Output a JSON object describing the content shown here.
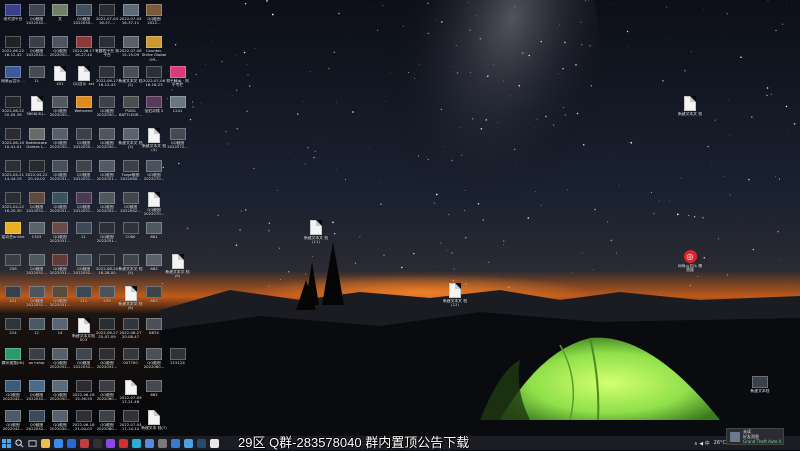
{
  "colors": {
    "taskbar": "#1b1d22",
    "tent": "#8fe04a",
    "horizon": "#e0661a",
    "sky": "#1a2130"
  },
  "desktop": {
    "icons": [
      {
        "label": "现代游平台",
        "kind": "app",
        "color": "#3a3f8a"
      },
      {
        "label": "QQ截图 2022042...",
        "kind": "shot",
        "color": "#3d4550"
      },
      {
        "label": "文",
        "kind": "app",
        "color": "#6f7f6a"
      },
      {
        "label": "QQ截图 2022050...",
        "kind": "shot",
        "color": "#41505e"
      },
      {
        "label": "2022-07-04 16-37-...",
        "kind": "shot",
        "color": "#2a2a30"
      },
      {
        "label": "2022-07-04 16-37-11",
        "kind": "shot",
        "color": "#5c6a78"
      },
      {
        "label": "QQ截图 2022...",
        "kind": "shot",
        "color": "#7a5a3a"
      },
      {
        "label": "2022-06-22 16-12-42",
        "kind": "shot",
        "color": "#202226"
      },
      {
        "label": "QQ截图 2022042...",
        "kind": "shot",
        "color": "#384046"
      },
      {
        "label": "QQ截图 2022050...",
        "kind": "shot",
        "color": "#4c5560"
      },
      {
        "label": "2022-06-17 16-27-40",
        "kind": "shot",
        "color": "#8a3a3a"
      },
      {
        "label": "有趣的平台 知平台",
        "kind": "shot",
        "color": "#2a2e35"
      },
      {
        "label": "2022-07-06 15-15-09",
        "kind": "shot",
        "color": "#5a6069"
      },
      {
        "label": "Counter-Strike Global Off...",
        "kind": "app",
        "color": "#c99a2e"
      },
      {
        "label": "网易云音乐 ...",
        "kind": "app",
        "color": "#3c5a9a"
      },
      {
        "label": "11",
        "kind": "shot",
        "color": "#454b55"
      },
      {
        "label": "451",
        "kind": "doc",
        "color": "#e8e8e8"
      },
      {
        "label": "QQ音乐 .txt",
        "kind": "doc",
        "color": "#e0e0e0"
      },
      {
        "label": "2022-06-17 16-12-43",
        "kind": "shot",
        "color": "#2f3338"
      },
      {
        "label": "新建文本文 档(2)",
        "kind": "shot",
        "color": "#4a4f57"
      },
      {
        "label": "2022-07-06 16-16-23",
        "kind": "shot",
        "color": "#2b2f37"
      },
      {
        "label": "和平精英 · 知乎专栏",
        "kind": "app",
        "color": "#d93a78"
      },
      {
        "label": "2022-06-22 20-05-36",
        "kind": "shot",
        "color": "#222428"
      },
      {
        "label": "3608(ID)...",
        "kind": "doc",
        "color": "#dcdcdc"
      },
      {
        "label": "QQ截图 2022050...",
        "kind": "shot",
        "color": "#505862"
      },
      {
        "label": "Wetnome",
        "kind": "app",
        "color": "#e08a1e"
      },
      {
        "label": "QQ截图 2022050...",
        "kind": "shot",
        "color": "#3c4249"
      },
      {
        "label": "PUBG BATTLEGR...",
        "kind": "app",
        "color": "#4d4d4d"
      },
      {
        "label": "仙侣奇缘 2",
        "kind": "app",
        "color": "#5a3a5a"
      },
      {
        "label": "1241",
        "kind": "shot",
        "color": "#6a7684"
      },
      {
        "label": "2022-06-10 10-41-01",
        "kind": "shot",
        "color": "#2a2c31"
      },
      {
        "label": "Battlestate Games L...",
        "kind": "app",
        "color": "#6a6a6a"
      },
      {
        "label": "QQ截图 2022050...",
        "kind": "shot",
        "color": "#56606a"
      },
      {
        "label": "QQ截图 2022050...",
        "kind": "shot",
        "color": "#3b4148"
      },
      {
        "label": "QQ截图 2022050...",
        "kind": "shot",
        "color": "#4e555d"
      },
      {
        "label": "新建文本文 档(3)",
        "kind": "shot",
        "color": "#5a6470"
      },
      {
        "label": "新建文本文 档(4)",
        "kind": "doc",
        "color": "#e8e8e8"
      },
      {
        "label": "QQ截图 2022072...",
        "kind": "shot",
        "color": "#434a52"
      },
      {
        "label": "2022-04-21 14-44-15",
        "kind": "shot",
        "color": "#2c3036"
      },
      {
        "label": "2022-04-22 20-10-02",
        "kind": "shot",
        "color": "#262a2e"
      },
      {
        "label": "QQ截图 2022051...",
        "kind": "shot",
        "color": "#48505a"
      },
      {
        "label": "QQ截图 2022051...",
        "kind": "shot",
        "color": "#3e444c"
      },
      {
        "label": "QQ截图 2022051...",
        "kind": "shot",
        "color": "#525a64"
      },
      {
        "label": "Fxige截图 2022060...",
        "kind": "shot",
        "color": "#3a4047"
      },
      {
        "label": "QQ截图 2022070...",
        "kind": "shot",
        "color": "#4a525c"
      },
      {
        "label": "2022-04-22 16-20-30",
        "kind": "shot",
        "color": "#2a2e33"
      },
      {
        "label": "QQ截图 2022051...",
        "kind": "shot",
        "color": "#5c4a3a"
      },
      {
        "label": "QQ截图 2022051...",
        "kind": "shot",
        "color": "#3a5260"
      },
      {
        "label": "QQ截图 2022051...",
        "kind": "shot",
        "color": "#4a3a52"
      },
      {
        "label": "QQ截图 2022052...",
        "kind": "shot",
        "color": "#50585f"
      },
      {
        "label": "QQ截图 2022062...",
        "kind": "shot",
        "color": "#3f464e"
      },
      {
        "label": "QQ截图 2022070...",
        "kind": "doc",
        "color": "#e8e8e8"
      },
      {
        "label": "爱奇艺online",
        "kind": "app",
        "color": "#e8b020"
      },
      {
        "label": "1353",
        "kind": "shot",
        "color": "#5a626c"
      },
      {
        "label": "QQ截图 2022051...",
        "kind": "shot",
        "color": "#6a4a4a"
      },
      {
        "label": "11",
        "kind": "shot",
        "color": "#3c4a58"
      },
      {
        "label": "QQ截图 2022051...",
        "kind": "shot",
        "color": "#2c3036"
      },
      {
        "label": "C080",
        "kind": "shot",
        "color": "#2f3338"
      },
      {
        "label": "881",
        "kind": "shot",
        "color": "#50585f"
      },
      {
        "label": "258",
        "kind": "shot",
        "color": "#3a3f46"
      },
      {
        "label": "QQ截图 2022051...",
        "kind": "shot",
        "color": "#4e565e"
      },
      {
        "label": "QQ截图 2022051...",
        "kind": "shot",
        "color": "#623a3a"
      },
      {
        "label": "QQ截图 2022052...",
        "kind": "shot",
        "color": "#48505a"
      },
      {
        "label": "2022-06-20 16-28-00",
        "kind": "shot",
        "color": "#2b2f35"
      },
      {
        "label": "新建文本文 档(5)",
        "kind": "shot",
        "color": "#3e454d"
      },
      {
        "label": "882",
        "kind": "shot",
        "color": "#5a6068"
      },
      {
        "label": "新建文本文 档(6)",
        "kind": "doc",
        "color": "#e8e8e8"
      },
      {
        "label": "421",
        "kind": "shot",
        "color": "#3a4048"
      },
      {
        "label": "QQ截图 2022051...",
        "kind": "shot",
        "color": "#4c545e"
      },
      {
        "label": "QQ截图 2022051...",
        "kind": "shot",
        "color": "#5a4a3c"
      },
      {
        "label": "111",
        "kind": "shot",
        "color": "#3a4a54"
      },
      {
        "label": "239",
        "kind": "shot",
        "color": "#4a525a"
      },
      {
        "label": "新建文本文 档(8)",
        "kind": "doc",
        "color": "#e8e8e8"
      },
      {
        "label": "883",
        "kind": "shot",
        "color": "#3c434b"
      },
      {
        "label": "214",
        "kind": "shot",
        "color": "#2f343a"
      },
      {
        "label": "12",
        "kind": "shot",
        "color": "#4a5862"
      },
      {
        "label": "14",
        "kind": "shot",
        "color": "#5a6470"
      },
      {
        "label": "新建文本文档003",
        "kind": "doc",
        "color": "#e8e8e8"
      },
      {
        "label": "2022-06-27 20-07-09",
        "kind": "shot",
        "color": "#2a2d32"
      },
      {
        "label": "2022-06-27 20-08-47",
        "kind": "shot",
        "color": "#33373d"
      },
      {
        "label": "8874",
        "kind": "shot",
        "color": "#4c5058"
      },
      {
        "label": "腾讯视频(Ht)",
        "kind": "app",
        "color": "#2a9a6a"
      },
      {
        "label": "on+ship",
        "kind": "shot",
        "color": "#3a3f46"
      },
      {
        "label": "QQ截图 2022052...",
        "kind": "shot",
        "color": "#56606a"
      },
      {
        "label": "QQ截图 2022052...",
        "kind": "shot",
        "color": "#3e454e"
      },
      {
        "label": "QQ截图 2022052...",
        "kind": "shot",
        "color": "#2b2e33"
      },
      {
        "label": "007700",
        "kind": "shot",
        "color": "#34383e"
      },
      {
        "label": "QQ截图 2022060...",
        "kind": "shot",
        "color": "#4a5058"
      },
      {
        "label": "215124",
        "kind": "shot",
        "color": "#2f3238"
      },
      {
        "label": "QQ截图 2022042...",
        "kind": "shot",
        "color": "#3c5a7a"
      },
      {
        "label": "QQ截图 2022042...",
        "kind": "shot",
        "color": "#4a6a8a"
      },
      {
        "label": "QQ截图 2022050...",
        "kind": "shot",
        "color": "#5a6a7a"
      },
      {
        "label": "2022-06-18 15-36-55",
        "kind": "shot",
        "color": "#2a2c31"
      },
      {
        "label": "QQ截图 2022060...",
        "kind": "shot",
        "color": "#3a3e44"
      },
      {
        "label": "2022-07-09 17-21-48",
        "kind": "doc",
        "color": "#e8e8e8"
      },
      {
        "label": "662",
        "kind": "shot",
        "color": "#45494f"
      },
      {
        "label": "QQ截图 2022042...",
        "kind": "shot",
        "color": "#4a5a6a"
      },
      {
        "label": "QQ截图 2022042...",
        "kind": "shot",
        "color": "#3a4a5a"
      },
      {
        "label": "QQ截图 2022050...",
        "kind": "shot",
        "color": "#56626e"
      },
      {
        "label": "2022-06-18 21-04-01",
        "kind": "shot",
        "color": "#2c2f34"
      },
      {
        "label": "QQ截图 2022060...",
        "kind": "shot",
        "color": "#3c4148"
      },
      {
        "label": "2022-07-04 17-14-14",
        "kind": "shot",
        "color": "#2f3338"
      },
      {
        "label": "新建文本 档(7)",
        "kind": "doc",
        "color": "#dcdcdc"
      }
    ],
    "free_icons": [
      {
        "label": "新建文本文 档",
        "kind": "doc"
      },
      {
        "label": "新建文本文 档(11)",
        "kind": "doc"
      },
      {
        "label": "新建文本文 档(12)",
        "kind": "doc"
      },
      {
        "label": "网易云音乐 播放器",
        "kind": "netease"
      },
      {
        "label": "新建文本档",
        "kind": "shot"
      }
    ]
  },
  "taskbar": {
    "start_icon": "windows-icon",
    "search_icon": "search-icon",
    "apps": [
      {
        "name": "file-explorer-icon",
        "color": "#e8c04a"
      },
      {
        "name": "chrome-icon",
        "color": "#3c8ae8"
      },
      {
        "name": "video-app-icon",
        "color": "#2a6ad0"
      },
      {
        "name": "game-launcher-icon",
        "color": "#c04040"
      },
      {
        "name": "terminal-icon",
        "color": "#303030"
      },
      {
        "name": "player-icon",
        "color": "#8a4ae8"
      },
      {
        "name": "music-icon",
        "color": "#d03030"
      },
      {
        "name": "edge-icon",
        "color": "#2ab0d8"
      },
      {
        "name": "store-icon",
        "color": "#5a8ae0"
      },
      {
        "name": "settings-icon",
        "color": "#7a7a7a"
      },
      {
        "name": "mail-icon",
        "color": "#3a7ad0"
      },
      {
        "name": "photos-icon",
        "color": "#4aa0e0"
      },
      {
        "name": "steam-icon",
        "color": "#2a4a6a"
      },
      {
        "name": "qq-icon",
        "color": "#e8e8e8"
      }
    ],
    "tray_temp": "26°C",
    "tray_label": "∧ ◀ 中"
  },
  "overlay_text": "29区 Q群-283578040   群内置顶公告下载",
  "notification": {
    "title": "未读",
    "line1": "好友消息",
    "line2": "Grand Theft Auto V"
  }
}
